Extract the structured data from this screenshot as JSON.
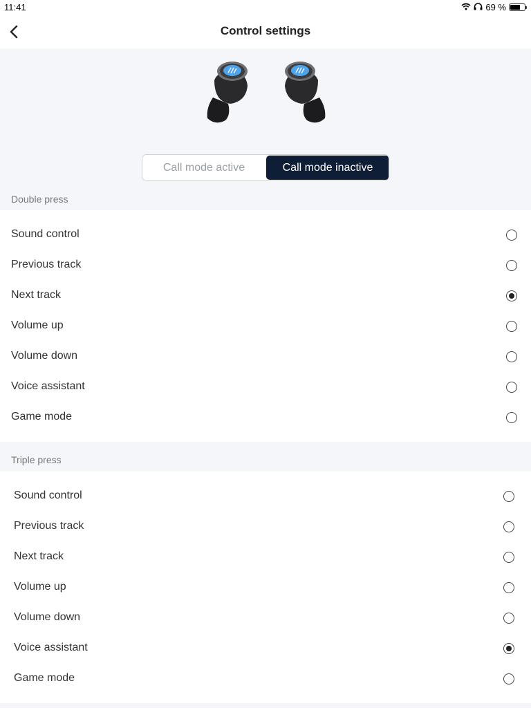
{
  "status_bar": {
    "time": "11:41",
    "battery_percent": "69 %",
    "battery_level": 0.69
  },
  "header": {
    "title": "Control settings"
  },
  "mode_toggle": {
    "options": [
      "Call mode active",
      "Call mode inactive"
    ],
    "selected": "Call mode inactive"
  },
  "sections": {
    "double_press": {
      "title": "Double press",
      "options": [
        "Sound control",
        "Previous track",
        "Next track",
        "Volume up",
        "Volume down",
        "Voice assistant",
        "Game mode"
      ],
      "selected": "Next track"
    },
    "triple_press": {
      "title": "Triple press",
      "options": [
        "Sound control",
        "Previous track",
        "Next track",
        "Volume up",
        "Volume down",
        "Voice assistant",
        "Game mode"
      ],
      "selected": "Voice assistant"
    }
  },
  "colors": {
    "accent": "#0f1e37",
    "page_background": "#f4f6fa",
    "earbud_highlight": "#4fa3e8"
  }
}
